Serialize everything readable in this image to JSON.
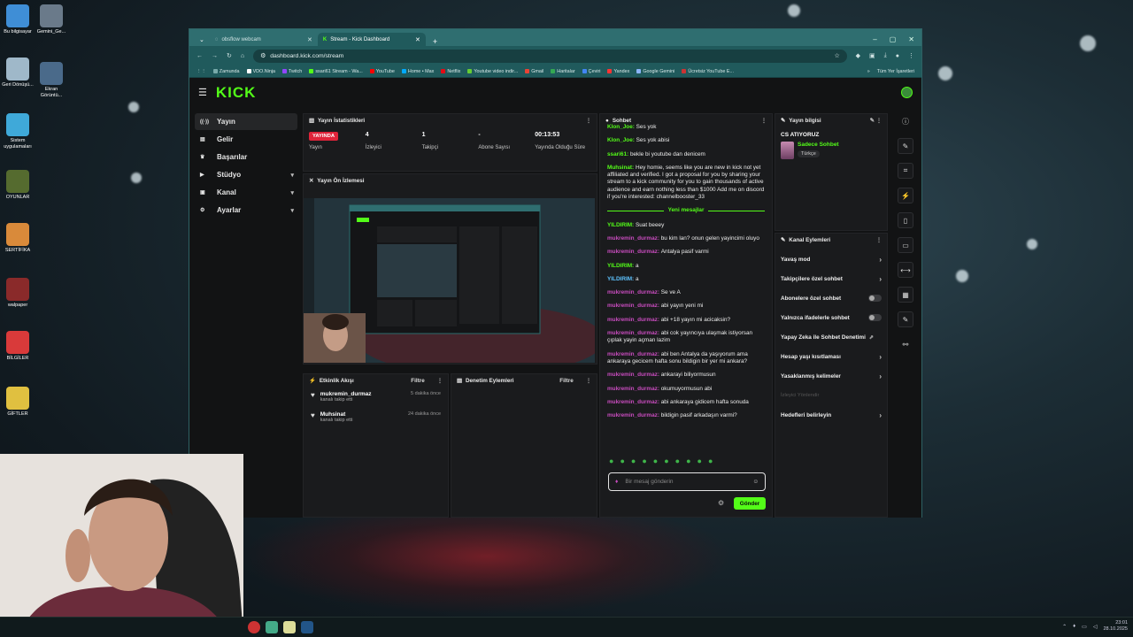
{
  "desktop": {
    "icons": [
      {
        "label": "Bu bilgisayar",
        "color": "#3f8ed6"
      },
      {
        "label": "Gemini_Ge...",
        "color": "#6a7a8a"
      },
      {
        "label": "Geri Dönüşü...",
        "color": "#9fb8c9"
      },
      {
        "label": "Ekran Görüntü...",
        "color": "#4a6a8a"
      },
      {
        "label": "Sistem uygulamaları",
        "color": "#3fa9d9"
      },
      {
        "label": "OYUNLAR",
        "color": "#556b2f"
      },
      {
        "label": "SERTİFİKA",
        "color": "#d98a3a"
      },
      {
        "label": "walpaper",
        "color": "#8a2a2a"
      },
      {
        "label": "BİLGİLER",
        "color": "#d93a3a"
      },
      {
        "label": "GİFTLER",
        "color": "#e0c040"
      }
    ]
  },
  "taskbar": {
    "time": "23:01",
    "date": "28.10.2025"
  },
  "browser": {
    "tabs": [
      {
        "title": "obsflow webcam",
        "active": false
      },
      {
        "title": "Stream - Kick Dashboard",
        "active": true
      }
    ],
    "url": "dashboard.kick.com/stream",
    "bookmarks": [
      {
        "label": "Zamunda",
        "c": "#7aa"
      },
      {
        "label": "VDO.Ninja",
        "c": "#fff"
      },
      {
        "label": "Twitch",
        "c": "#9146ff"
      },
      {
        "label": "ssari61 Stream - Wa...",
        "c": "#53fc18"
      },
      {
        "label": "YouTube",
        "c": "#f00"
      },
      {
        "label": "Home • Max",
        "c": "#0af"
      },
      {
        "label": "Netflix",
        "c": "#e50914"
      },
      {
        "label": "Youtube video indir...",
        "c": "#6c3"
      },
      {
        "label": "Gmail",
        "c": "#ea4335"
      },
      {
        "label": "Haritalar",
        "c": "#34a853"
      },
      {
        "label": "Çeviri",
        "c": "#4285f4"
      },
      {
        "label": "Yandex",
        "c": "#f33"
      },
      {
        "label": "Google Gemini",
        "c": "#8ab4f8"
      },
      {
        "label": "Ücretsiz YouTube E...",
        "c": "#c33"
      }
    ],
    "all_bookmarks": "Tüm Yer İşaretleri"
  },
  "kick": {
    "logo": "KICK",
    "nav": [
      {
        "label": "Yayın",
        "icon": "broadcast-icon",
        "active": true,
        "chev": ""
      },
      {
        "label": "Gelir",
        "icon": "revenue-icon",
        "active": false,
        "chev": ""
      },
      {
        "label": "Başarılar",
        "icon": "trophy-icon",
        "active": false,
        "chev": ""
      },
      {
        "label": "Stüdyo",
        "icon": "studio-icon",
        "active": false,
        "chev": "▾"
      },
      {
        "label": "Kanal",
        "icon": "channel-icon",
        "active": false,
        "chev": "▾"
      },
      {
        "label": "Ayarlar",
        "icon": "settings-icon",
        "active": false,
        "chev": "▾"
      }
    ],
    "stats": {
      "title": "Yayın İstatistikleri",
      "items": [
        {
          "value": "YAYINDA",
          "label": "Yayın",
          "badge": true
        },
        {
          "value": "4",
          "label": "İzleyici"
        },
        {
          "value": "1",
          "label": "Takipçi"
        },
        {
          "value": "-",
          "label": "Abone Sayısı"
        },
        {
          "value": "00:13:53",
          "label": "Yayında Olduğu Süre"
        }
      ]
    },
    "preview": {
      "title": "Yayın Ön İzlemesi"
    },
    "activity": {
      "title": "Etkinlik Akışı",
      "filter": "Filtre",
      "events": [
        {
          "name": "mukremin_durmaz",
          "sub": "kanalı takip etti",
          "ago": "5 dakika önce"
        },
        {
          "name": "Muhsinat",
          "sub": "kanalı takip etti",
          "ago": "24 dakika önce"
        }
      ]
    },
    "moderation": {
      "title": "Denetim Eylemleri",
      "filter": "Filtre"
    },
    "chat": {
      "title": "Sohbet",
      "messages": [
        {
          "user": "Klon_Joe",
          "text": "Ses yok",
          "cls": "u-g"
        },
        {
          "user": "Klon_Joe",
          "text": "Ses yok abisi",
          "cls": "u-g"
        },
        {
          "user": "ssari61",
          "text": "bekle bi youtube dan denicem",
          "cls": "u-g"
        },
        {
          "user": "Muhsinat",
          "text": "Hey homie, seems like you are new in kick not yet affiliated and verified. I got a proposal for you by sharing your stream to a kick community for you to gain thousands of active audience and earn nothing less than $1000 Add me on discord if you're interested: channelbooster_33",
          "cls": "u-g"
        }
      ],
      "new_messages": "Yeni mesajlar",
      "messages2": [
        {
          "user": "YILDIRIM",
          "text": "Suat beeey",
          "cls": "u-g"
        },
        {
          "user": "mukremin_durmaz",
          "text": "bu kim lan? onun gelen yayincimi oluyo",
          "cls": "u-p"
        },
        {
          "user": "mukremin_durmaz",
          "text": "Antalya pasif varmi",
          "cls": "u-p"
        },
        {
          "user": "YILDIRIM",
          "text": "a",
          "cls": "u-g"
        },
        {
          "user": "YILDIRIM",
          "text": "a",
          "cls": "u-t"
        },
        {
          "user": "mukremin_durmaz",
          "text": "Se ve A",
          "cls": "u-p"
        },
        {
          "user": "mukremin_durmaz",
          "text": "abi yayın yeni mi",
          "cls": "u-p"
        },
        {
          "user": "mukremin_durmaz",
          "text": "abi +18 yayın mi acicaksin?",
          "cls": "u-p"
        },
        {
          "user": "mukremin_durmaz",
          "text": "abi cok yayıncıya ulaşmak istiyorsan çıplak yayin açman lazim",
          "cls": "u-p"
        },
        {
          "user": "mukremin_durmaz",
          "text": "abi ben Antalya da yaşıyorum ama ankaraya gecicem hafta sonu bildigin bir yer mi ankara?",
          "cls": "u-p"
        },
        {
          "user": "mukremin_durmaz",
          "text": "ankarayi biliyormusun",
          "cls": "u-p"
        },
        {
          "user": "mukremin_durmaz",
          "text": "okumuyormusun abi",
          "cls": "u-p"
        },
        {
          "user": "mukremin_durmaz",
          "text": "abi ankaraya gidicem hafta sonuda",
          "cls": "u-p"
        },
        {
          "user": "mukremin_durmaz",
          "text": "bildigin pasif arkadaşın varmi?",
          "cls": "u-p"
        }
      ],
      "placeholder": "Bir mesaj gönderin",
      "send": "Gönder"
    },
    "info": {
      "title": "Yayın bilgisi",
      "stream_title": "CS ATIYORUZ",
      "category": "Sadece Sohbet",
      "language": "Türkçe"
    },
    "channel": {
      "title": "Kanal Eylemleri",
      "rows": [
        {
          "label": "Yavaş mod",
          "kind": "arrow",
          "disabled": false
        },
        {
          "label": "Takipçilere özel sohbet",
          "kind": "arrow",
          "disabled": false
        },
        {
          "label": "Abonelere özel sohbet",
          "kind": "toggle",
          "disabled": false
        },
        {
          "label": "Yalnızca ifadelerle sohbet",
          "kind": "toggle",
          "disabled": false
        },
        {
          "label": "Yapay Zeka ile Sohbet Denetimi",
          "kind": "ext",
          "disabled": false
        },
        {
          "label": "Hesap yaşı kısıtlaması",
          "kind": "arrow",
          "disabled": false
        },
        {
          "label": "Yasaklanmış kelimeler",
          "kind": "arrow",
          "disabled": false
        },
        {
          "label": "İzleyici Yönlendir",
          "kind": "none",
          "disabled": true
        },
        {
          "label": "Hedefleri belirleyin",
          "kind": "arrow",
          "disabled": false
        }
      ]
    }
  }
}
